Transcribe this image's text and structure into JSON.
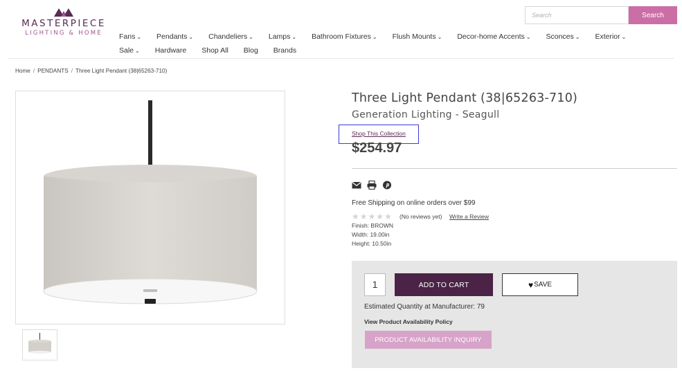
{
  "brand": {
    "name": "MASTERPIECE",
    "tagline": "LIGHTING & HOME"
  },
  "search": {
    "placeholder": "Search",
    "button_label": "Search"
  },
  "nav": {
    "row1": [
      {
        "label": "Fans",
        "dropdown": true
      },
      {
        "label": "Pendants",
        "dropdown": true
      },
      {
        "label": "Chandeliers",
        "dropdown": true
      },
      {
        "label": "Lamps",
        "dropdown": true
      },
      {
        "label": "Bathroom Fixtures",
        "dropdown": true
      },
      {
        "label": "Flush Mounts",
        "dropdown": true
      },
      {
        "label": "Decor-home Accents",
        "dropdown": true
      },
      {
        "label": "Sconces",
        "dropdown": true
      },
      {
        "label": "Exterior",
        "dropdown": true
      }
    ],
    "row2": [
      {
        "label": "Sale",
        "dropdown": true
      },
      {
        "label": "Hardware",
        "dropdown": false
      },
      {
        "label": "Shop All",
        "dropdown": false
      },
      {
        "label": "Blog",
        "dropdown": false
      },
      {
        "label": "Brands",
        "dropdown": false
      }
    ]
  },
  "breadcrumb": [
    "Home",
    "PENDANTS",
    "Three Light Pendant (38|65263-710)"
  ],
  "product": {
    "title": "Three Light Pendant (38|65263-710)",
    "brand_line": "Generation Lighting - Seagull",
    "collection_link": "Shop This Collection",
    "price": "$254.97",
    "shipping": "Free Shipping on online orders over $99",
    "rating_stars": 0,
    "rating_max": 5,
    "reviews_text": "(No reviews yet)",
    "write_review": "Write a Review",
    "specs": [
      "Finish: BROWN",
      "Width: 19.00in",
      "Height: 10.50in"
    ]
  },
  "share_icons": [
    "email-icon",
    "print-icon",
    "pinterest-icon"
  ],
  "purchase": {
    "quantity": "1",
    "add_to_cart": "ADD TO CART",
    "save": "SAVE",
    "estimated_quantity": "Estimated Quantity at Manufacturer: 79",
    "policy_link": "View Product Availability Policy",
    "inquiry_button": "PRODUCT AVAILABILITY INQUIRY"
  },
  "colors": {
    "brand_purple": "#5b2a55",
    "search_button": "#cc6ea6",
    "add_to_cart": "#4b2346",
    "inquiry_button": "#d7a3c8",
    "panel_bg": "#e6e6e6"
  }
}
